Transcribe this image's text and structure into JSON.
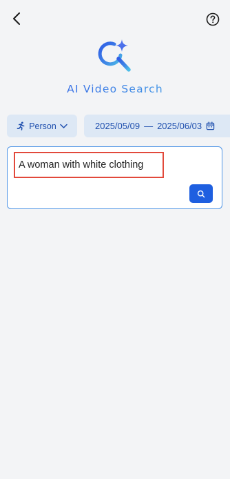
{
  "header": {
    "back_icon": "chevron-left-icon",
    "help_icon": "question-circle-icon"
  },
  "branding": {
    "logo_icon": "magnifier-sparkle-icon",
    "title": "AI Video Search",
    "colors": {
      "gradient_start": "#3459e6",
      "gradient_end": "#47aee8"
    }
  },
  "filters": {
    "type": {
      "icon": "running-person-icon",
      "label": "Person",
      "chevron_icon": "chevron-down-icon"
    },
    "date_range": {
      "start": "2025/05/09",
      "separator": "—",
      "end": "2025/06/03",
      "icon": "calendar-icon"
    }
  },
  "search": {
    "query": "A woman with white clothing",
    "button_icon": "search-icon",
    "accent_color": "#1e5fe0",
    "highlight_color": "#e2493b"
  }
}
